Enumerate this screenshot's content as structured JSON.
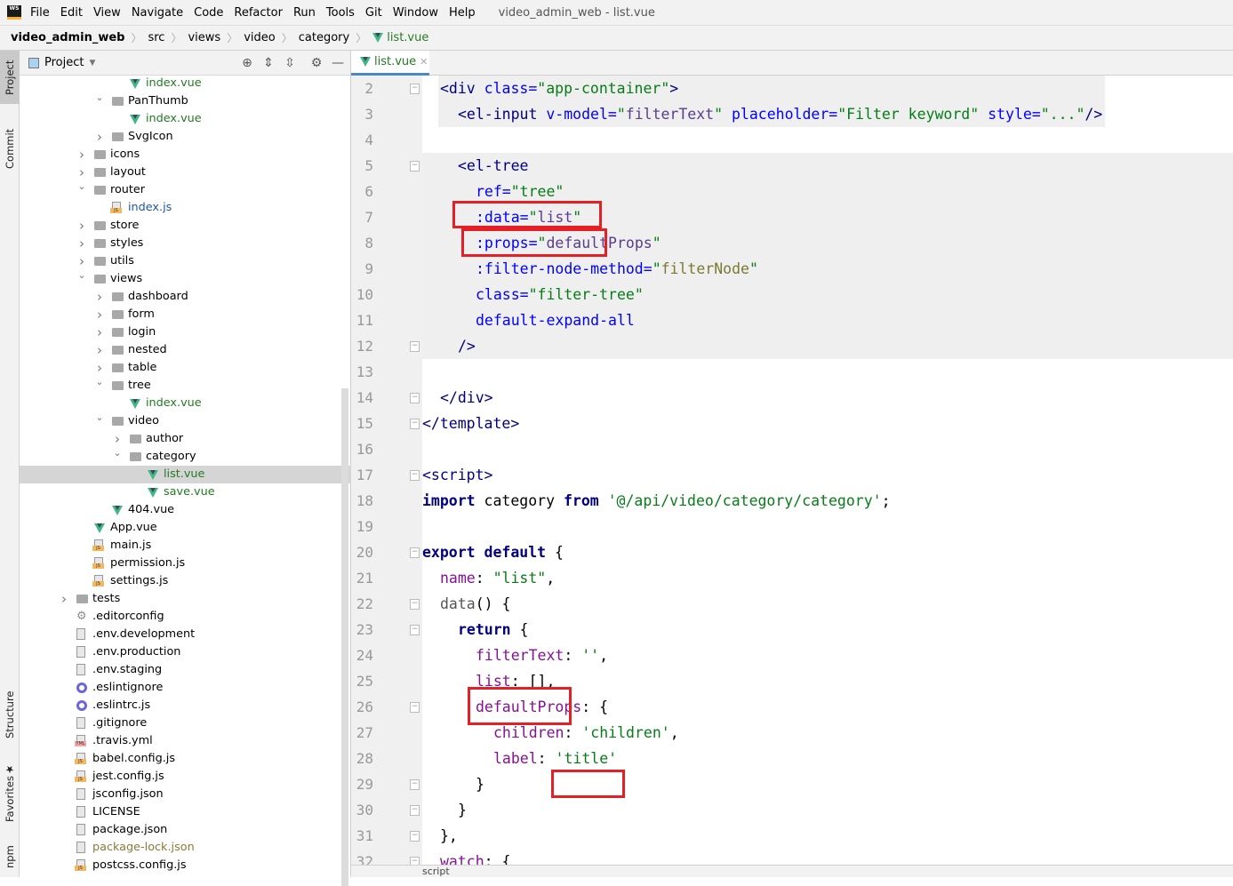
{
  "app": {
    "logo": "WS EAP",
    "window_title": "video_admin_web - list.vue"
  },
  "menu": [
    "File",
    "Edit",
    "View",
    "Navigate",
    "Code",
    "Refactor",
    "Run",
    "Tools",
    "Git",
    "Window",
    "Help"
  ],
  "breadcrumb": [
    "video_admin_web",
    "src",
    "views",
    "video",
    "category",
    "list.vue"
  ],
  "side_tabs": {
    "project": "Project",
    "commit": "Commit",
    "structure": "Structure",
    "favorites": "Favorites",
    "npm": "npm"
  },
  "project_panel": {
    "title": "Project",
    "tree": [
      {
        "label": "index.vue",
        "type": "vue",
        "level": 3
      },
      {
        "label": "PanThumb",
        "type": "folder",
        "level": 2,
        "state": "open"
      },
      {
        "label": "index.vue",
        "type": "vue",
        "level": 3
      },
      {
        "label": "SvgIcon",
        "type": "folder",
        "level": 2,
        "state": "closed"
      },
      {
        "label": "icons",
        "type": "folder",
        "level": 1,
        "state": "closed"
      },
      {
        "label": "layout",
        "type": "folder",
        "level": 1,
        "state": "closed"
      },
      {
        "label": "router",
        "type": "folder",
        "level": 1,
        "state": "open"
      },
      {
        "label": "index.js",
        "type": "js",
        "level": 2,
        "vcolor": "vue"
      },
      {
        "label": "store",
        "type": "folder",
        "level": 1,
        "state": "closed"
      },
      {
        "label": "styles",
        "type": "folder",
        "level": 1,
        "state": "closed"
      },
      {
        "label": "utils",
        "type": "folder",
        "level": 1,
        "state": "closed"
      },
      {
        "label": "views",
        "type": "folder",
        "level": 1,
        "state": "open"
      },
      {
        "label": "dashboard",
        "type": "folder",
        "level": 2,
        "state": "closed"
      },
      {
        "label": "form",
        "type": "folder",
        "level": 2,
        "state": "closed"
      },
      {
        "label": "login",
        "type": "folder",
        "level": 2,
        "state": "closed"
      },
      {
        "label": "nested",
        "type": "folder",
        "level": 2,
        "state": "closed"
      },
      {
        "label": "table",
        "type": "folder",
        "level": 2,
        "state": "closed"
      },
      {
        "label": "tree",
        "type": "folder",
        "level": 2,
        "state": "open"
      },
      {
        "label": "index.vue",
        "type": "vue",
        "level": 3
      },
      {
        "label": "video",
        "type": "folder",
        "level": 2,
        "state": "open"
      },
      {
        "label": "author",
        "type": "folder",
        "level": 3,
        "state": "closed"
      },
      {
        "label": "category",
        "type": "folder",
        "level": 3,
        "state": "open"
      },
      {
        "label": "list.vue",
        "type": "vue",
        "level": 4,
        "selected": true
      },
      {
        "label": "save.vue",
        "type": "vue",
        "level": 4
      },
      {
        "label": "404.vue",
        "type": "vue",
        "level": 2,
        "plain": true
      },
      {
        "label": "App.vue",
        "type": "vue",
        "level": 1,
        "plain": true
      },
      {
        "label": "main.js",
        "type": "js",
        "level": 1
      },
      {
        "label": "permission.js",
        "type": "js",
        "level": 1
      },
      {
        "label": "settings.js",
        "type": "js",
        "level": 1
      },
      {
        "label": "tests",
        "type": "folder",
        "level": 0,
        "state": "closed"
      },
      {
        "label": ".editorconfig",
        "type": "gear",
        "level": 0
      },
      {
        "label": ".env.development",
        "type": "file",
        "level": 0
      },
      {
        "label": ".env.production",
        "type": "file",
        "level": 0
      },
      {
        "label": ".env.staging",
        "type": "file",
        "level": 0
      },
      {
        "label": ".eslintignore",
        "type": "eslint",
        "level": 0
      },
      {
        "label": ".eslintrc.js",
        "type": "eslint",
        "level": 0
      },
      {
        "label": ".gitignore",
        "type": "file",
        "level": 0
      },
      {
        "label": ".travis.yml",
        "type": "yml",
        "level": 0
      },
      {
        "label": "babel.config.js",
        "type": "js",
        "level": 0
      },
      {
        "label": "jest.config.js",
        "type": "js",
        "level": 0
      },
      {
        "label": "jsconfig.json",
        "type": "json",
        "level": 0
      },
      {
        "label": "LICENSE",
        "type": "file",
        "level": 0
      },
      {
        "label": "package.json",
        "type": "json",
        "level": 0
      },
      {
        "label": "package-lock.json",
        "type": "json",
        "level": 0,
        "muted": true
      },
      {
        "label": "postcss.config.js",
        "type": "js",
        "level": 0
      }
    ]
  },
  "editor": {
    "tab": "list.vue",
    "status": "script",
    "lines": [
      {
        "n": 2,
        "fold": true,
        "indent": 1,
        "tokens": [
          [
            "tag",
            "<div "
          ],
          [
            "attr",
            "class="
          ],
          [
            "val",
            "\"app-container\""
          ],
          [
            "tag",
            ">"
          ]
        ]
      },
      {
        "n": 3,
        "indent": 2,
        "tokens": [
          [
            "tag",
            "<el-input "
          ],
          [
            "attr",
            "v-model="
          ],
          [
            "val",
            "\""
          ],
          [
            "ref",
            "filterText"
          ],
          [
            "val",
            "\""
          ],
          [
            "tag",
            " "
          ],
          [
            "attr",
            "placeholder="
          ],
          [
            "val",
            "\"Filter keyword\""
          ],
          [
            "tag",
            " "
          ],
          [
            "attr",
            "style="
          ],
          [
            "val",
            "\"...\""
          ],
          [
            "tag",
            "/>"
          ]
        ]
      },
      {
        "n": 4,
        "indent": 0,
        "tokens": []
      },
      {
        "n": 5,
        "fold": true,
        "indent": 2,
        "tokens": [
          [
            "tag",
            "<el-tree"
          ]
        ]
      },
      {
        "n": 6,
        "indent": 3,
        "tokens": [
          [
            "attr",
            "ref="
          ],
          [
            "val",
            "\"tree\""
          ]
        ]
      },
      {
        "n": 7,
        "indent": 3,
        "tokens": [
          [
            "attr",
            ":data="
          ],
          [
            "val",
            "\""
          ],
          [
            "ref",
            "list"
          ],
          [
            "val",
            "\""
          ]
        ]
      },
      {
        "n": 8,
        "indent": 3,
        "tokens": [
          [
            "attr",
            ":props="
          ],
          [
            "val",
            "\""
          ],
          [
            "ref",
            "defaultProps"
          ],
          [
            "val",
            "\""
          ]
        ]
      },
      {
        "n": 9,
        "indent": 3,
        "tokens": [
          [
            "attr",
            ":filter-node-method="
          ],
          [
            "val",
            "\""
          ],
          [
            "fn",
            "filterNode"
          ],
          [
            "val",
            "\""
          ]
        ]
      },
      {
        "n": 10,
        "indent": 3,
        "tokens": [
          [
            "attr",
            "class="
          ],
          [
            "val",
            "\"filter-tree\""
          ]
        ]
      },
      {
        "n": 11,
        "indent": 3,
        "tokens": [
          [
            "attr",
            "default-expand-all"
          ]
        ]
      },
      {
        "n": 12,
        "fold": true,
        "indent": 2,
        "tokens": [
          [
            "tag",
            "/>"
          ]
        ]
      },
      {
        "n": 13,
        "indent": 0,
        "tokens": []
      },
      {
        "n": 14,
        "fold": true,
        "indent": 1,
        "tokens": [
          [
            "tag",
            "</div>"
          ]
        ]
      },
      {
        "n": 15,
        "fold": true,
        "indent": 0,
        "tokens": [
          [
            "tag",
            "</template>"
          ]
        ]
      },
      {
        "n": 16,
        "indent": 0,
        "tokens": []
      },
      {
        "n": 17,
        "fold": true,
        "indent": 0,
        "tokens": [
          [
            "tag",
            "<script>"
          ]
        ]
      },
      {
        "n": 18,
        "indent": 0,
        "tokens": [
          [
            "kw",
            "import "
          ],
          [
            "plain",
            "category "
          ],
          [
            "kw",
            "from "
          ],
          [
            "str",
            "'@/api/video/category/category'"
          ],
          [
            "plain",
            ";"
          ]
        ]
      },
      {
        "n": 19,
        "indent": 0,
        "tokens": []
      },
      {
        "n": 20,
        "fold": true,
        "indent": 0,
        "tokens": [
          [
            "kw",
            "export default "
          ],
          [
            "plain",
            "{"
          ]
        ]
      },
      {
        "n": 21,
        "indent": 1,
        "tokens": [
          [
            "prop",
            "name"
          ],
          [
            "plain",
            ": "
          ],
          [
            "str",
            "\"list\""
          ],
          [
            "plain",
            ","
          ]
        ]
      },
      {
        "n": 22,
        "fold": true,
        "indent": 1,
        "tokens": [
          [
            "fname",
            "data"
          ],
          [
            "plain",
            "() {"
          ]
        ]
      },
      {
        "n": 23,
        "fold": true,
        "indent": 2,
        "tokens": [
          [
            "kw",
            "return "
          ],
          [
            "plain",
            "{"
          ]
        ]
      },
      {
        "n": 24,
        "indent": 3,
        "tokens": [
          [
            "prop",
            "filterText"
          ],
          [
            "plain",
            ": "
          ],
          [
            "str",
            "''"
          ],
          [
            "plain",
            ","
          ]
        ]
      },
      {
        "n": 25,
        "indent": 3,
        "tokens": [
          [
            "prop",
            "list"
          ],
          [
            "plain",
            ": [],"
          ]
        ]
      },
      {
        "n": 26,
        "fold": true,
        "indent": 3,
        "tokens": [
          [
            "prop",
            "defaultProps"
          ],
          [
            "plain",
            ": {"
          ]
        ]
      },
      {
        "n": 27,
        "indent": 4,
        "tokens": [
          [
            "prop",
            "children"
          ],
          [
            "plain",
            ": "
          ],
          [
            "str",
            "'children'"
          ],
          [
            "plain",
            ","
          ]
        ]
      },
      {
        "n": 28,
        "indent": 4,
        "tokens": [
          [
            "prop",
            "label"
          ],
          [
            "plain",
            ": "
          ],
          [
            "str",
            "'title'"
          ]
        ]
      },
      {
        "n": 29,
        "fold": true,
        "indent": 3,
        "tokens": [
          [
            "plain",
            "}"
          ]
        ]
      },
      {
        "n": 30,
        "fold": true,
        "indent": 2,
        "tokens": [
          [
            "plain",
            "}"
          ]
        ]
      },
      {
        "n": 31,
        "fold": true,
        "indent": 1,
        "tokens": [
          [
            "plain",
            "},"
          ]
        ]
      },
      {
        "n": 32,
        "fold": true,
        "indent": 1,
        "tokens": [
          [
            "prop",
            "watch"
          ],
          [
            "plain",
            ": {"
          ]
        ]
      }
    ]
  },
  "colors": {
    "highlight_box": "#e41f26",
    "vue_green": "#41b883",
    "tab_underline": "#4a88c7"
  }
}
